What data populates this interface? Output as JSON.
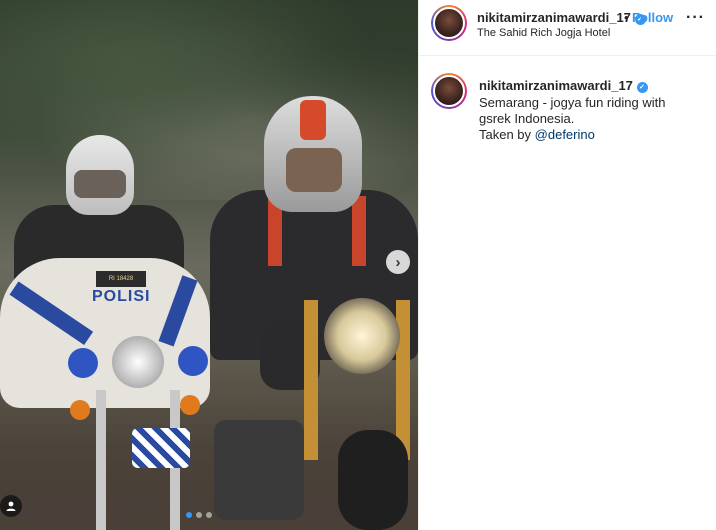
{
  "post": {
    "media": {
      "alt_visible_text": "POLISI",
      "carousel": {
        "total_dots": 3,
        "active_index": 0
      },
      "next_button_glyph": "›",
      "police_badge_text": "RI 18428"
    },
    "header": {
      "username": "nikitamirzanimawardi_17",
      "verified_glyph": "✓",
      "separator": "•",
      "follow_label": "Follow",
      "location": "The Sahid Rich Jogja Hotel",
      "more_glyph": "···"
    },
    "caption": {
      "username": "nikitamirzanimawardi_17",
      "verified_glyph": "✓",
      "lines": [
        "Semarang - jogya fun riding with",
        "gsrek Indonesia."
      ],
      "credit_prefix": "Taken by ",
      "credit_mention": "@deferino"
    }
  },
  "colors": {
    "accent": "#3897f0",
    "text": "#262626",
    "mention": "#00376b",
    "police_blue": "#2a4aa0"
  },
  "icons": [
    "user-tag-icon",
    "carousel-next-icon",
    "verified-badge-icon",
    "more-options-icon"
  ]
}
